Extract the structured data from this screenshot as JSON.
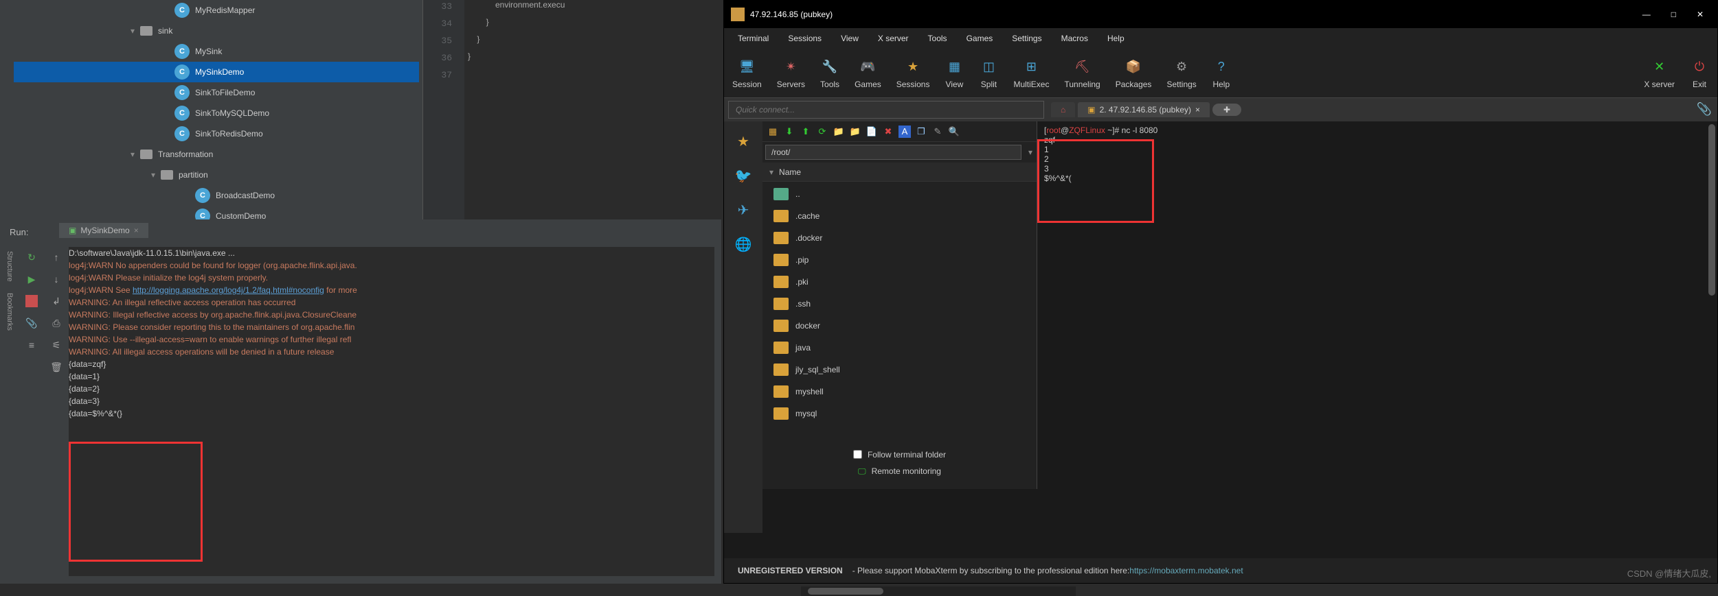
{
  "ide": {
    "tree": [
      {
        "indent": 220,
        "icon": "class",
        "label": "MyRedisMapper",
        "sel": false,
        "arrow": ""
      },
      {
        "indent": 170,
        "icon": "pkg",
        "label": "sink",
        "sel": false,
        "arrow": "▾"
      },
      {
        "indent": 220,
        "icon": "class",
        "label": "MySink",
        "sel": false,
        "arrow": ""
      },
      {
        "indent": 220,
        "icon": "class",
        "label": "MySinkDemo",
        "sel": true,
        "arrow": ""
      },
      {
        "indent": 220,
        "icon": "class",
        "label": "SinkToFileDemo",
        "sel": false,
        "arrow": ""
      },
      {
        "indent": 220,
        "icon": "class",
        "label": "SinkToMySQLDemo",
        "sel": false,
        "arrow": ""
      },
      {
        "indent": 220,
        "icon": "class",
        "label": "SinkToRedisDemo",
        "sel": false,
        "arrow": ""
      },
      {
        "indent": 170,
        "icon": "pkg",
        "label": "Transformation",
        "sel": false,
        "arrow": "▾"
      },
      {
        "indent": 200,
        "icon": "pkg",
        "label": "partition",
        "sel": false,
        "arrow": "▾"
      },
      {
        "indent": 250,
        "icon": "class",
        "label": "BroadcastDemo",
        "sel": false,
        "arrow": ""
      },
      {
        "indent": 250,
        "icon": "class",
        "label": "CustomDemo",
        "sel": false,
        "arrow": ""
      }
    ],
    "editor": {
      "lines": [
        "33",
        "34",
        "35",
        "36",
        "37"
      ],
      "code": [
        "            environment.execu",
        "        }",
        "    }",
        "}",
        ""
      ]
    },
    "run_label": "Run:",
    "run_tab": "MySinkDemo",
    "console": [
      {
        "cls": "ln",
        "text": "D:\\software\\Java\\jdk-11.0.15.1\\bin\\java.exe ..."
      },
      {
        "cls": "warn",
        "text": "log4j:WARN No appenders could be found for logger (org.apache.flink.api.java."
      },
      {
        "cls": "warn",
        "text": "log4j:WARN Please initialize the log4j system properly."
      },
      {
        "cls": "warn",
        "text": "log4j:WARN See ",
        "link": "http://logging.apache.org/log4j/1.2/faq.html#noconfig",
        "tail": " for more"
      },
      {
        "cls": "warn",
        "text": "WARNING: An illegal reflective access operation has occurred"
      },
      {
        "cls": "warn",
        "text": "WARNING: Illegal reflective access by org.apache.flink.api.java.ClosureCleane"
      },
      {
        "cls": "warn",
        "text": "WARNING: Please consider reporting this to the maintainers of org.apache.flin"
      },
      {
        "cls": "warn",
        "text": "WARNING: Use --illegal-access=warn to enable warnings of further illegal refl"
      },
      {
        "cls": "warn",
        "text": "WARNING: All illegal access operations will be denied in a future release"
      },
      {
        "cls": "ln",
        "text": "{data=zqf}"
      },
      {
        "cls": "ln",
        "text": "{data=1}"
      },
      {
        "cls": "ln",
        "text": "{data=2}"
      },
      {
        "cls": "ln",
        "text": "{data=3}"
      },
      {
        "cls": "ln",
        "text": "{data=$%^&*(}"
      }
    ]
  },
  "moba": {
    "title": "47.92.146.85 (pubkey)",
    "menus": [
      "Terminal",
      "Sessions",
      "View",
      "X server",
      "Tools",
      "Games",
      "Settings",
      "Macros",
      "Help"
    ],
    "toolbar": [
      {
        "label": "Session",
        "color": "#4aa5d6",
        "glyph": "🖥"
      },
      {
        "label": "Servers",
        "color": "#d66",
        "glyph": "✴"
      },
      {
        "label": "Tools",
        "color": "#d9a23a",
        "glyph": "🔧"
      },
      {
        "label": "Games",
        "color": "#ccc",
        "glyph": "🎮"
      },
      {
        "label": "Sessions",
        "color": "#d9a23a",
        "glyph": "★"
      },
      {
        "label": "View",
        "color": "#4aa5d6",
        "glyph": "▦"
      },
      {
        "label": "Split",
        "color": "#4aa5d6",
        "glyph": "◫"
      },
      {
        "label": "MultiExec",
        "color": "#4aa5d6",
        "glyph": "⊞"
      },
      {
        "label": "Tunneling",
        "color": "#d66",
        "glyph": "⛏"
      },
      {
        "label": "Packages",
        "color": "#b87333",
        "glyph": "📦"
      },
      {
        "label": "Settings",
        "color": "#999",
        "glyph": "⚙"
      },
      {
        "label": "Help",
        "color": "#4aa5d6",
        "glyph": "?"
      }
    ],
    "toolbar_right": [
      {
        "label": "X server",
        "color": "#3c3",
        "glyph": "✕"
      },
      {
        "label": "Exit",
        "color": "#d44",
        "glyph": "⏻"
      }
    ],
    "quick_placeholder": "Quick connect...",
    "tab_home": "⌂",
    "tab_active": "2. 47.92.146.85 (pubkey)",
    "path": "/root/",
    "name_header": "Name",
    "files": [
      {
        "name": "..",
        "up": true
      },
      {
        "name": ".cache"
      },
      {
        "name": ".docker"
      },
      {
        "name": ".pip"
      },
      {
        "name": ".pki"
      },
      {
        "name": ".ssh"
      },
      {
        "name": "docker"
      },
      {
        "name": "java"
      },
      {
        "name": "jly_sql_shell"
      },
      {
        "name": "myshell"
      },
      {
        "name": "mysql"
      }
    ],
    "follow_label": "Follow terminal folder",
    "remote_label": "Remote monitoring",
    "term": {
      "prompt_user": "root",
      "prompt_host": "ZQFLinux",
      "prompt_path": "~",
      "prompt_suffix": "#",
      "command": "nc -l 8080",
      "output": [
        "zqf",
        "1",
        "2",
        "3",
        "$%^&*("
      ]
    },
    "status_prefix": "UNREGISTERED VERSION",
    "status_mid": "  -   Please support MobaXterm by subscribing to the professional edition here:  ",
    "status_link": "https://mobaxterm.mobatek.net"
  },
  "watermark": "CSDN @情绪大瓜皮,"
}
